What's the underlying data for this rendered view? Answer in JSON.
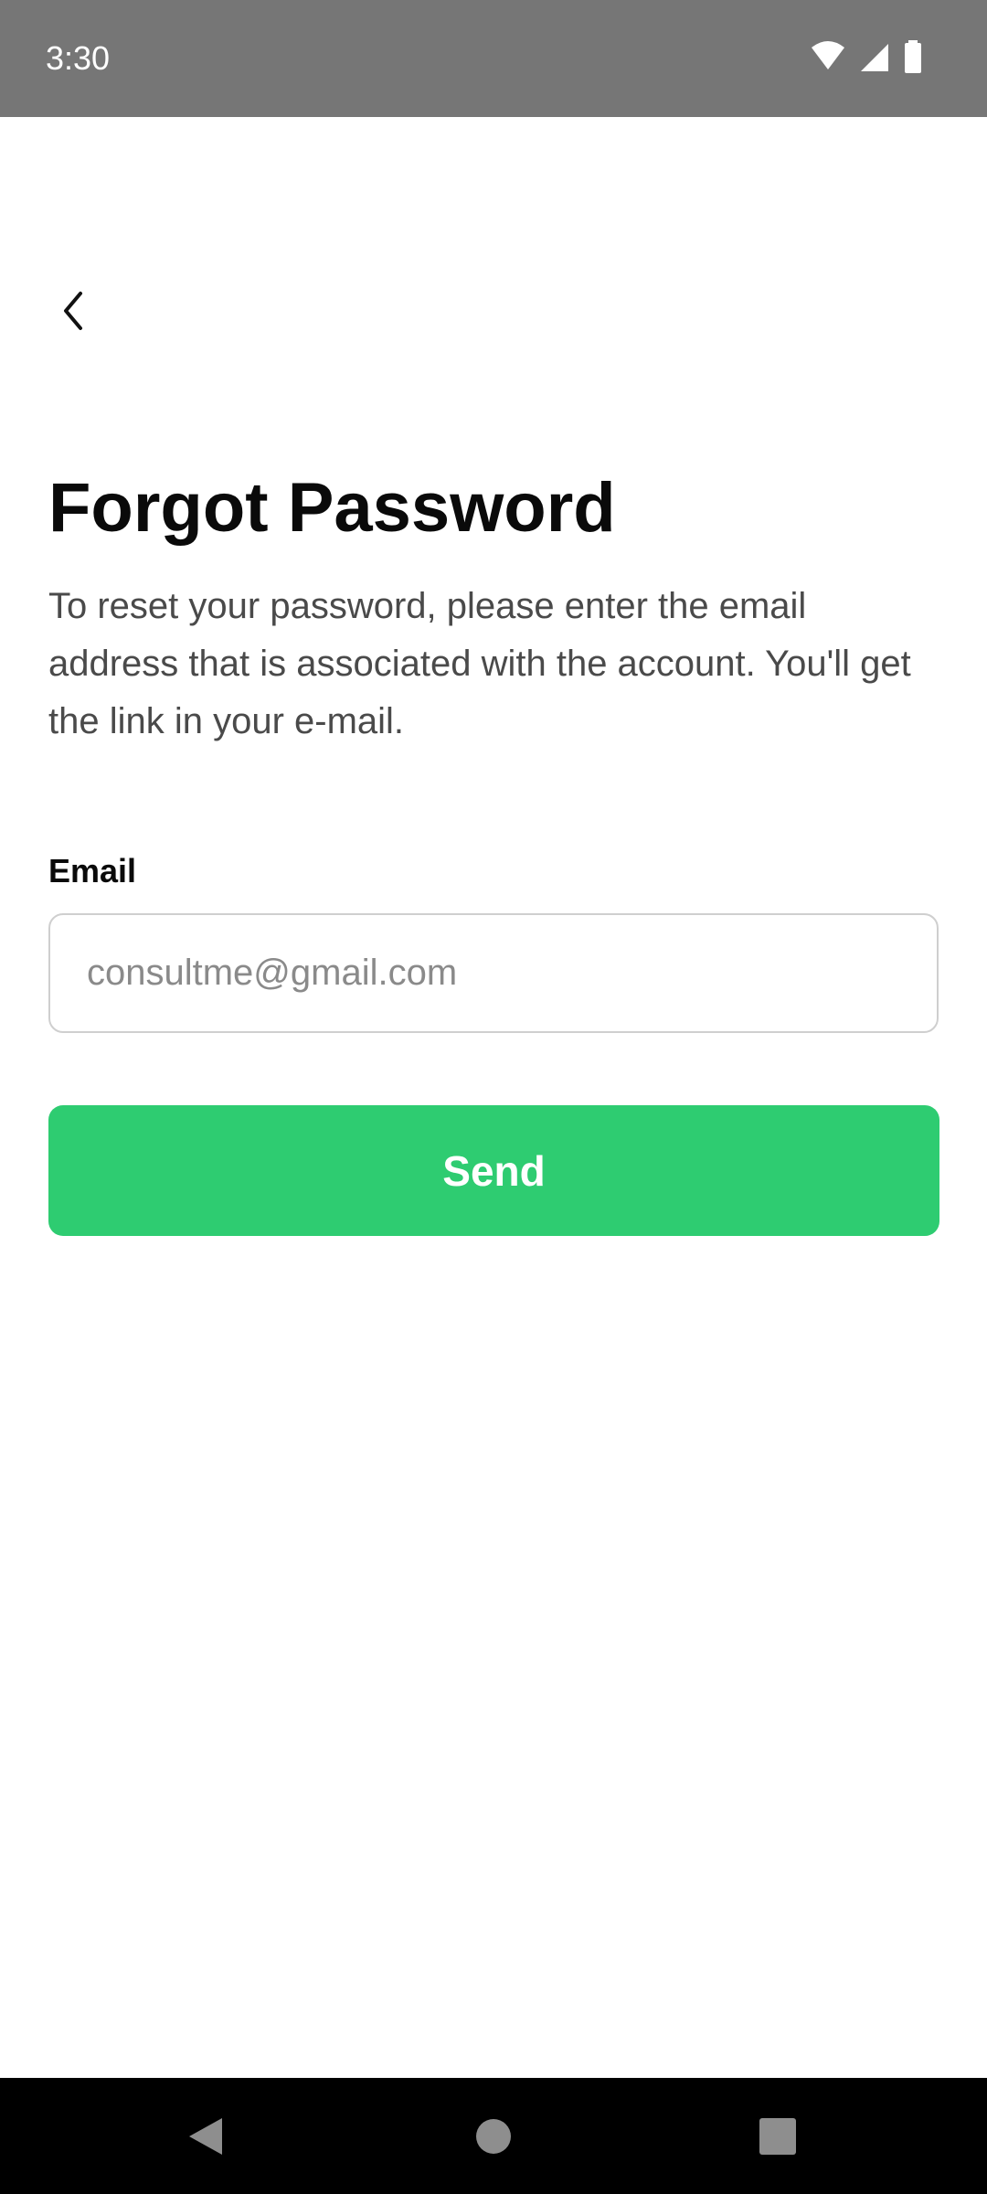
{
  "status_bar": {
    "time": "3:30",
    "icons": [
      "wifi-icon",
      "cellular-signal-icon",
      "battery-icon"
    ]
  },
  "header": {
    "back_icon": "chevron-left-icon"
  },
  "main": {
    "title": "Forgot Password",
    "description": "To reset your password, please enter the email address that is associated with the account. You'll get the link in your e-mail.",
    "email_label": "Email",
    "email_placeholder": "consultme@gmail.com",
    "email_value": "",
    "send_label": "Send"
  },
  "nav_bar": {
    "icons": [
      "nav-back-icon",
      "nav-home-icon",
      "nav-recents-icon"
    ]
  },
  "colors": {
    "accent": "#2ecc71",
    "status_bar": "#767676",
    "nav_bar": "#000000"
  }
}
